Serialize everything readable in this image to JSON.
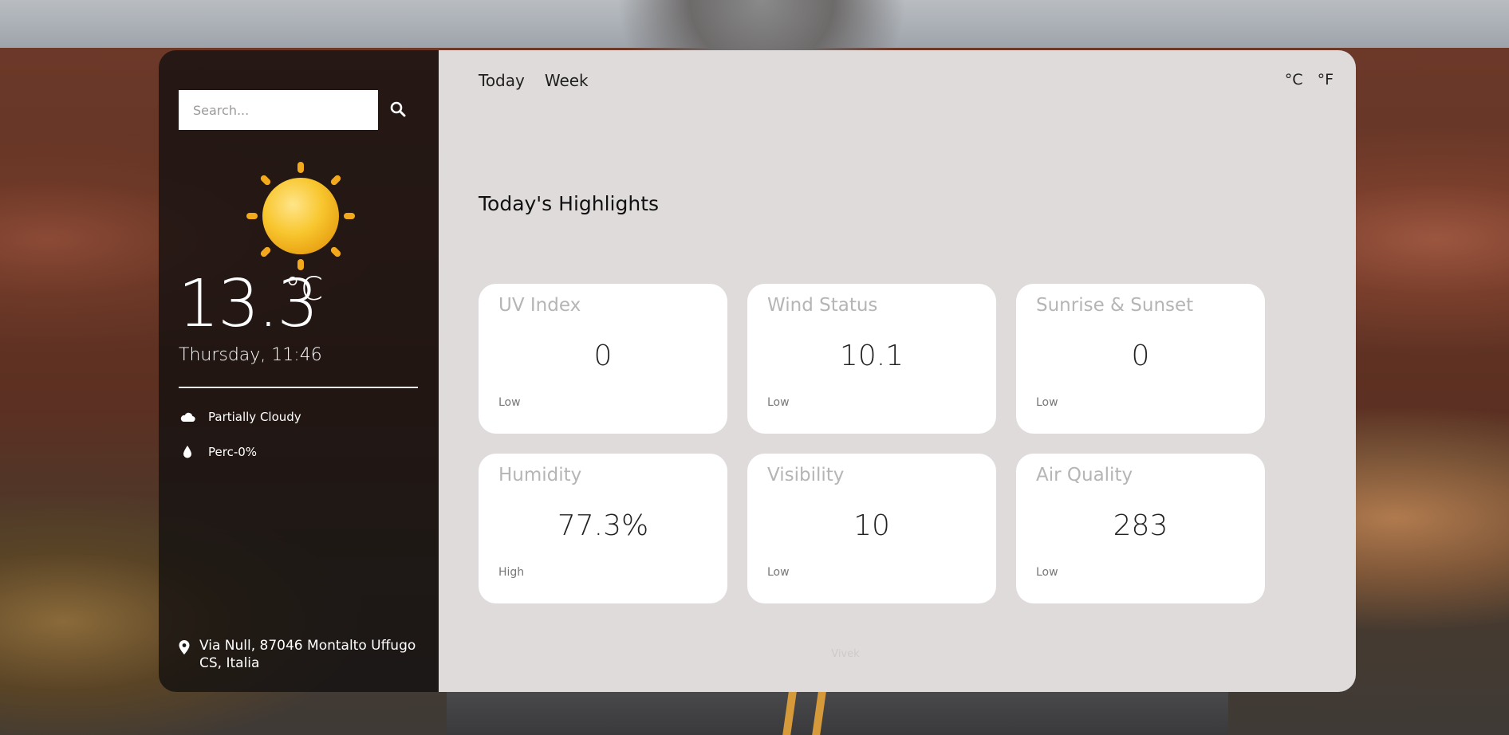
{
  "search": {
    "placeholder": "Search..."
  },
  "weather": {
    "temperature": "13.3",
    "unit": "°C",
    "datetime": "Thursday, 11:46",
    "condition": "Partially Cloudy",
    "precipitation": "Perc-0%"
  },
  "location": {
    "line1": "Via Null, 87046 Montalto Uffugo",
    "line2": "CS, Italia"
  },
  "tabs": [
    {
      "label": "Today"
    },
    {
      "label": "Week"
    }
  ],
  "units": [
    {
      "label": "°C"
    },
    {
      "label": "°F"
    }
  ],
  "highlights": {
    "title": "Today's Highlights",
    "cards": [
      {
        "title": "UV Index",
        "value": "0",
        "status": "Low"
      },
      {
        "title": "Wind Status",
        "value": "10.1",
        "status": "Low"
      },
      {
        "title": "Sunrise & Sunset",
        "value": "0",
        "status": "Low"
      },
      {
        "title": "Humidity",
        "value": "77.3%",
        "status": "High"
      },
      {
        "title": "Visibility",
        "value": "10",
        "status": "Low"
      },
      {
        "title": "Air Quality",
        "value": "283",
        "status": "Low"
      }
    ]
  },
  "footer": {
    "author": "Vivek"
  },
  "icons": {
    "search": "search-icon",
    "sun": "sun-icon",
    "cloud": "cloud-icon",
    "drop": "drop-icon",
    "location": "location-pin-icon"
  },
  "colors": {
    "panel": "#dfdbdb",
    "card": "#ffffff",
    "sidebar": "#121010",
    "sun": "#f5b82a"
  }
}
